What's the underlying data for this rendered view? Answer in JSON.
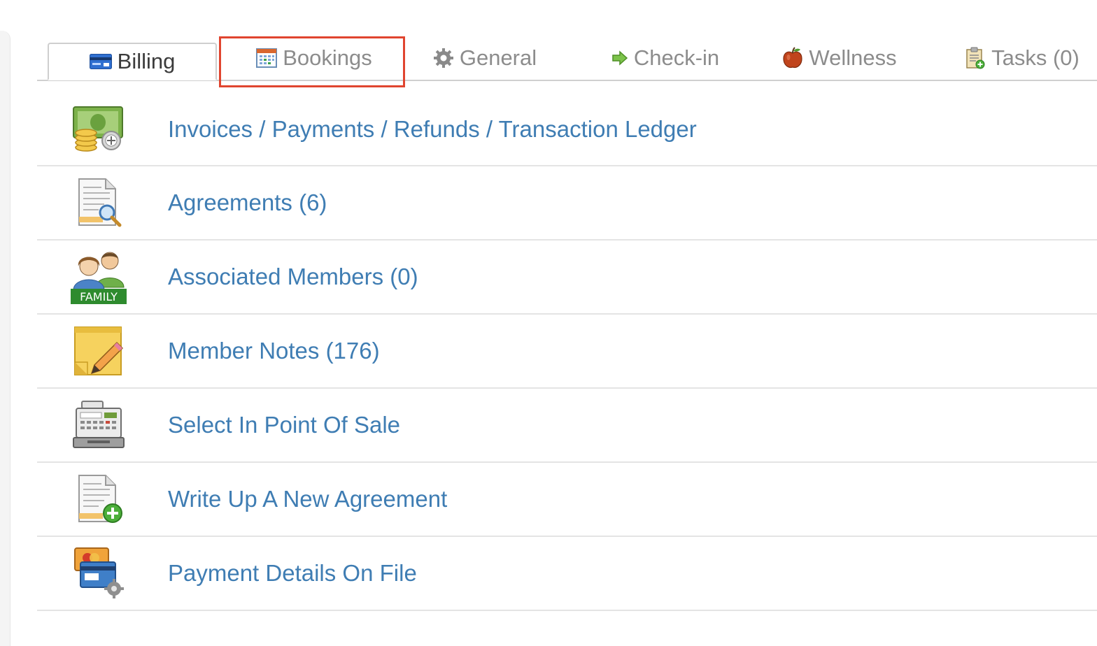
{
  "tabs": [
    {
      "id": "billing",
      "label": "Billing",
      "icon": "credit-card-icon",
      "active": true
    },
    {
      "id": "bookings",
      "label": "Bookings",
      "icon": "calendar-icon",
      "active": false,
      "highlighted": true
    },
    {
      "id": "general",
      "label": "General",
      "icon": "gear-icon",
      "active": false
    },
    {
      "id": "check-in",
      "label": "Check-in",
      "icon": "arrow-right-icon",
      "active": false
    },
    {
      "id": "wellness",
      "label": "Wellness",
      "icon": "apple-icon",
      "active": false
    },
    {
      "id": "tasks",
      "label": "Tasks (0)",
      "icon": "clipboard-add-icon",
      "active": false
    }
  ],
  "menu": [
    {
      "id": "invoices",
      "label": "Invoices / Payments / Refunds / Transaction Ledger",
      "icon": "money-coins-icon"
    },
    {
      "id": "agreements",
      "label": "Agreements (6)",
      "icon": "document-search-icon"
    },
    {
      "id": "associated-members",
      "label": "Associated Members (0)",
      "icon": "family-icon",
      "icon_text": "FAMILY"
    },
    {
      "id": "member-notes",
      "label": "Member Notes (176)",
      "icon": "note-pencil-icon"
    },
    {
      "id": "point-of-sale",
      "label": "Select In Point Of Sale",
      "icon": "cash-register-icon"
    },
    {
      "id": "new-agreement",
      "label": "Write Up A New Agreement",
      "icon": "document-add-icon"
    },
    {
      "id": "payment-details",
      "label": "Payment Details On File",
      "icon": "credit-cards-gear-icon"
    }
  ],
  "colors": {
    "link": "#3f7db3",
    "tab_text": "#8c8c8c",
    "tab_active_text": "#3b3b3b",
    "highlight": "#e0452f",
    "divider": "#e4e4e4"
  }
}
